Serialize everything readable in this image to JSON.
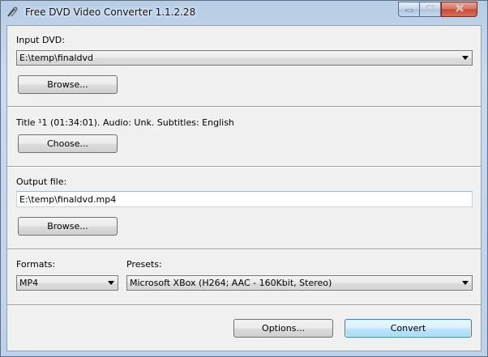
{
  "window": {
    "title": "Free DVD Video Converter 1.1.2.28",
    "icon": "dvd-converter-app-icon",
    "controls": {
      "minimize_icon": "minimize-icon",
      "maximize_icon": "maximize-icon",
      "close_icon": "close-icon"
    }
  },
  "input": {
    "label": "Input DVD:",
    "value": "E:\\temp\\finaldvd",
    "browse_label": "Browse..."
  },
  "title_info": {
    "text": "Title ¹1 (01:34:01).  Audio: Unk.  Subtitles: English",
    "choose_label": "Choose..."
  },
  "output": {
    "label": "Output file:",
    "value": "E:\\temp\\finaldvd.mp4",
    "browse_label": "Browse..."
  },
  "formats": {
    "label": "Formats:",
    "selected": "MP4"
  },
  "presets": {
    "label": "Presets:",
    "selected": "Microsoft XBox (H264; AAC - 160Kbit, Stereo)"
  },
  "actions": {
    "options_label": "Options...",
    "convert_label": "Convert"
  },
  "colors": {
    "title_bar": "#bcd2ea",
    "client_bg": "#f0f0f0",
    "default_button": "#bee6fd",
    "close_button": "#c2482f"
  }
}
